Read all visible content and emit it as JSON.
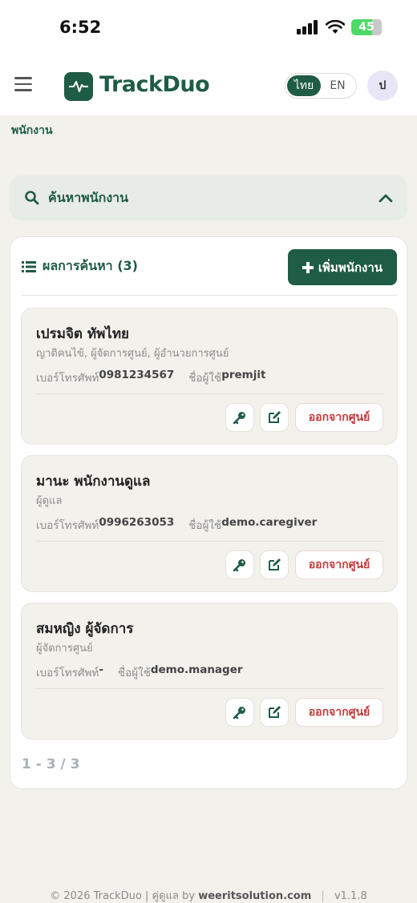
{
  "status_bar": {
    "time": "6:52",
    "battery": "45"
  },
  "header": {
    "brand": "TrackDuo",
    "lang_th": "ไทย",
    "lang_en": "EN",
    "avatar_initial": "ป"
  },
  "breadcrumb": "พนักงาน",
  "search_panel": {
    "title": "ค้นหาพนักงาน"
  },
  "results": {
    "title": "ผลการค้นหา (3)",
    "add_button": "เพิ่มพนักงาน",
    "phone_label": "เบอร์โทรศัพท์",
    "username_label": "ชื่อผู้ใช้",
    "leave_label": "ออกจากศูนย์",
    "employees": [
      {
        "name": "เปรมจิต ทัพไทย",
        "roles": "ญาติคนไข้, ผู้จัดการศูนย์, ผู้อำนวยการศูนย์",
        "phone": "0981234567",
        "username": "premjit"
      },
      {
        "name": "มานะ พนักงานดูแล",
        "roles": "ผู้ดูแล",
        "phone": "0996263053",
        "username": "demo.caregiver"
      },
      {
        "name": "สมหญิง ผู้จัดการ",
        "roles": "ผู้จัดการศูนย์",
        "phone": "-",
        "username": "demo.manager"
      }
    ],
    "pagination": "1 - 3 / 3"
  },
  "footer": {
    "copyright": "© 2026 TrackDuo | คู่ดูแล by ",
    "company": "weeritsolution.com",
    "separator": "|",
    "version": "v1.1.8"
  },
  "colors": {
    "brand": "#1f5c45",
    "danger": "#c43a3a",
    "background": "#f2f1ec"
  }
}
